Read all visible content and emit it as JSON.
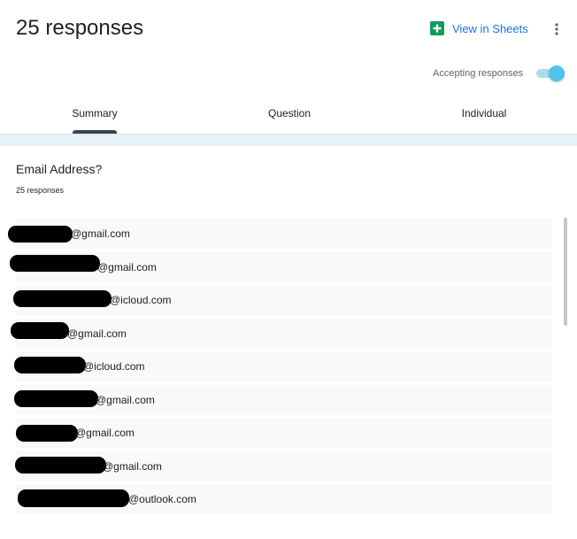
{
  "header": {
    "title": "25 responses",
    "sheets_label": "View in Sheets",
    "sheets_icon": "google-sheets-icon",
    "more_icon": "more-vert-icon",
    "accepting_label": "Accepting responses",
    "accepting_on": true
  },
  "tabs": {
    "summary": "Summary",
    "question": "Question",
    "individual": "Individual",
    "active": "Summary"
  },
  "question": {
    "title": "Email Address?",
    "count": "25 responses"
  },
  "responses": [
    {
      "domain": "@gmail.com"
    },
    {
      "domain": "@gmail.com"
    },
    {
      "domain": "@icloud.com"
    },
    {
      "domain": "@gmail.com"
    },
    {
      "domain": "@icloud.com"
    },
    {
      "domain": "@gmail.com"
    },
    {
      "domain": "@gmail.com"
    },
    {
      "domain": "@gmail.com"
    },
    {
      "domain": "@outlook.com"
    }
  ],
  "colors": {
    "accent": "#1a73e8",
    "toggle_knob": "#4fc3e9",
    "toggle_track": "#a8dcef",
    "sheets_green": "#0f9d58",
    "tab_indicator": "#37474f"
  }
}
